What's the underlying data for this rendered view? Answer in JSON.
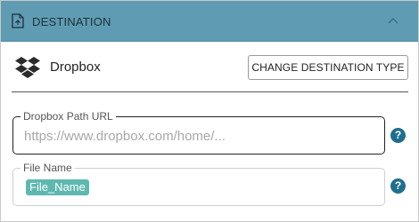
{
  "header": {
    "title": "DESTINATION",
    "icon": "document-icon",
    "collapse_icon": "chevron-up-icon"
  },
  "service": {
    "icon": "dropbox-icon",
    "name": "Dropbox",
    "change_button_label": "CHANGE DESTINATION TYPE"
  },
  "fields": {
    "path": {
      "label": "Dropbox Path URL",
      "placeholder": "https://www.dropbox.com/home/..."
    },
    "file_name": {
      "label": "File Name",
      "token": "File_Name"
    },
    "help_glyph": "?"
  },
  "colors": {
    "header_bg": "#5f9cb4",
    "chip_bg": "#5fb8b0",
    "help_bg": "#1e6f8f",
    "dropbox_icon": "#2b2b2b"
  }
}
